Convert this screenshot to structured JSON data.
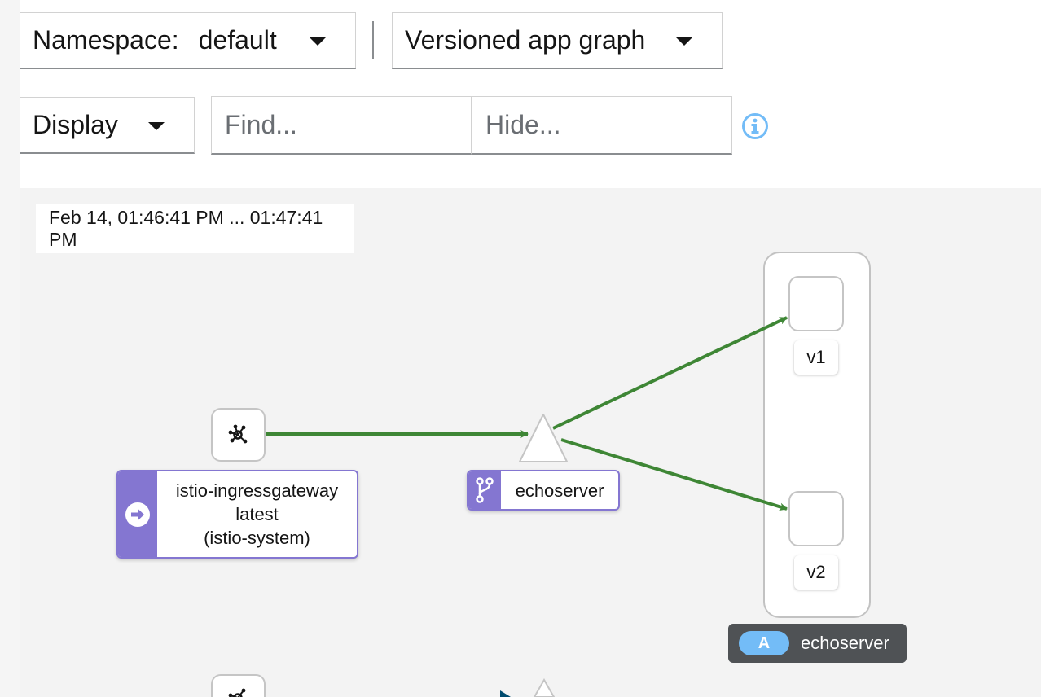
{
  "toolbar": {
    "namespace_label": "Namespace:",
    "namespace_value": "default",
    "graph_type": "Versioned app graph",
    "display_label": "Display",
    "find_placeholder": "Find...",
    "hide_placeholder": "Hide...",
    "info_icon": "info-circle-icon"
  },
  "graph": {
    "time_range": "Feb 14, 01:46:41 PM ... 01:47:41 PM",
    "gateway": {
      "icon": "gateway-icon",
      "badge_icon": "arrow-right-circle-icon",
      "name": "istio-ingressgateway",
      "version": "latest",
      "namespace": "(istio-system)"
    },
    "service": {
      "badge_icon": "branch-icon",
      "name": "echoserver"
    },
    "versions": [
      "v1",
      "v2"
    ],
    "app": {
      "badge": "A",
      "name": "echoserver"
    },
    "colors": {
      "edge": "#3e8635",
      "badge": "#8476d1",
      "app_pill": "#73bcf7",
      "app_tag_bg": "#4f5255",
      "info": "#73bcf7"
    }
  }
}
